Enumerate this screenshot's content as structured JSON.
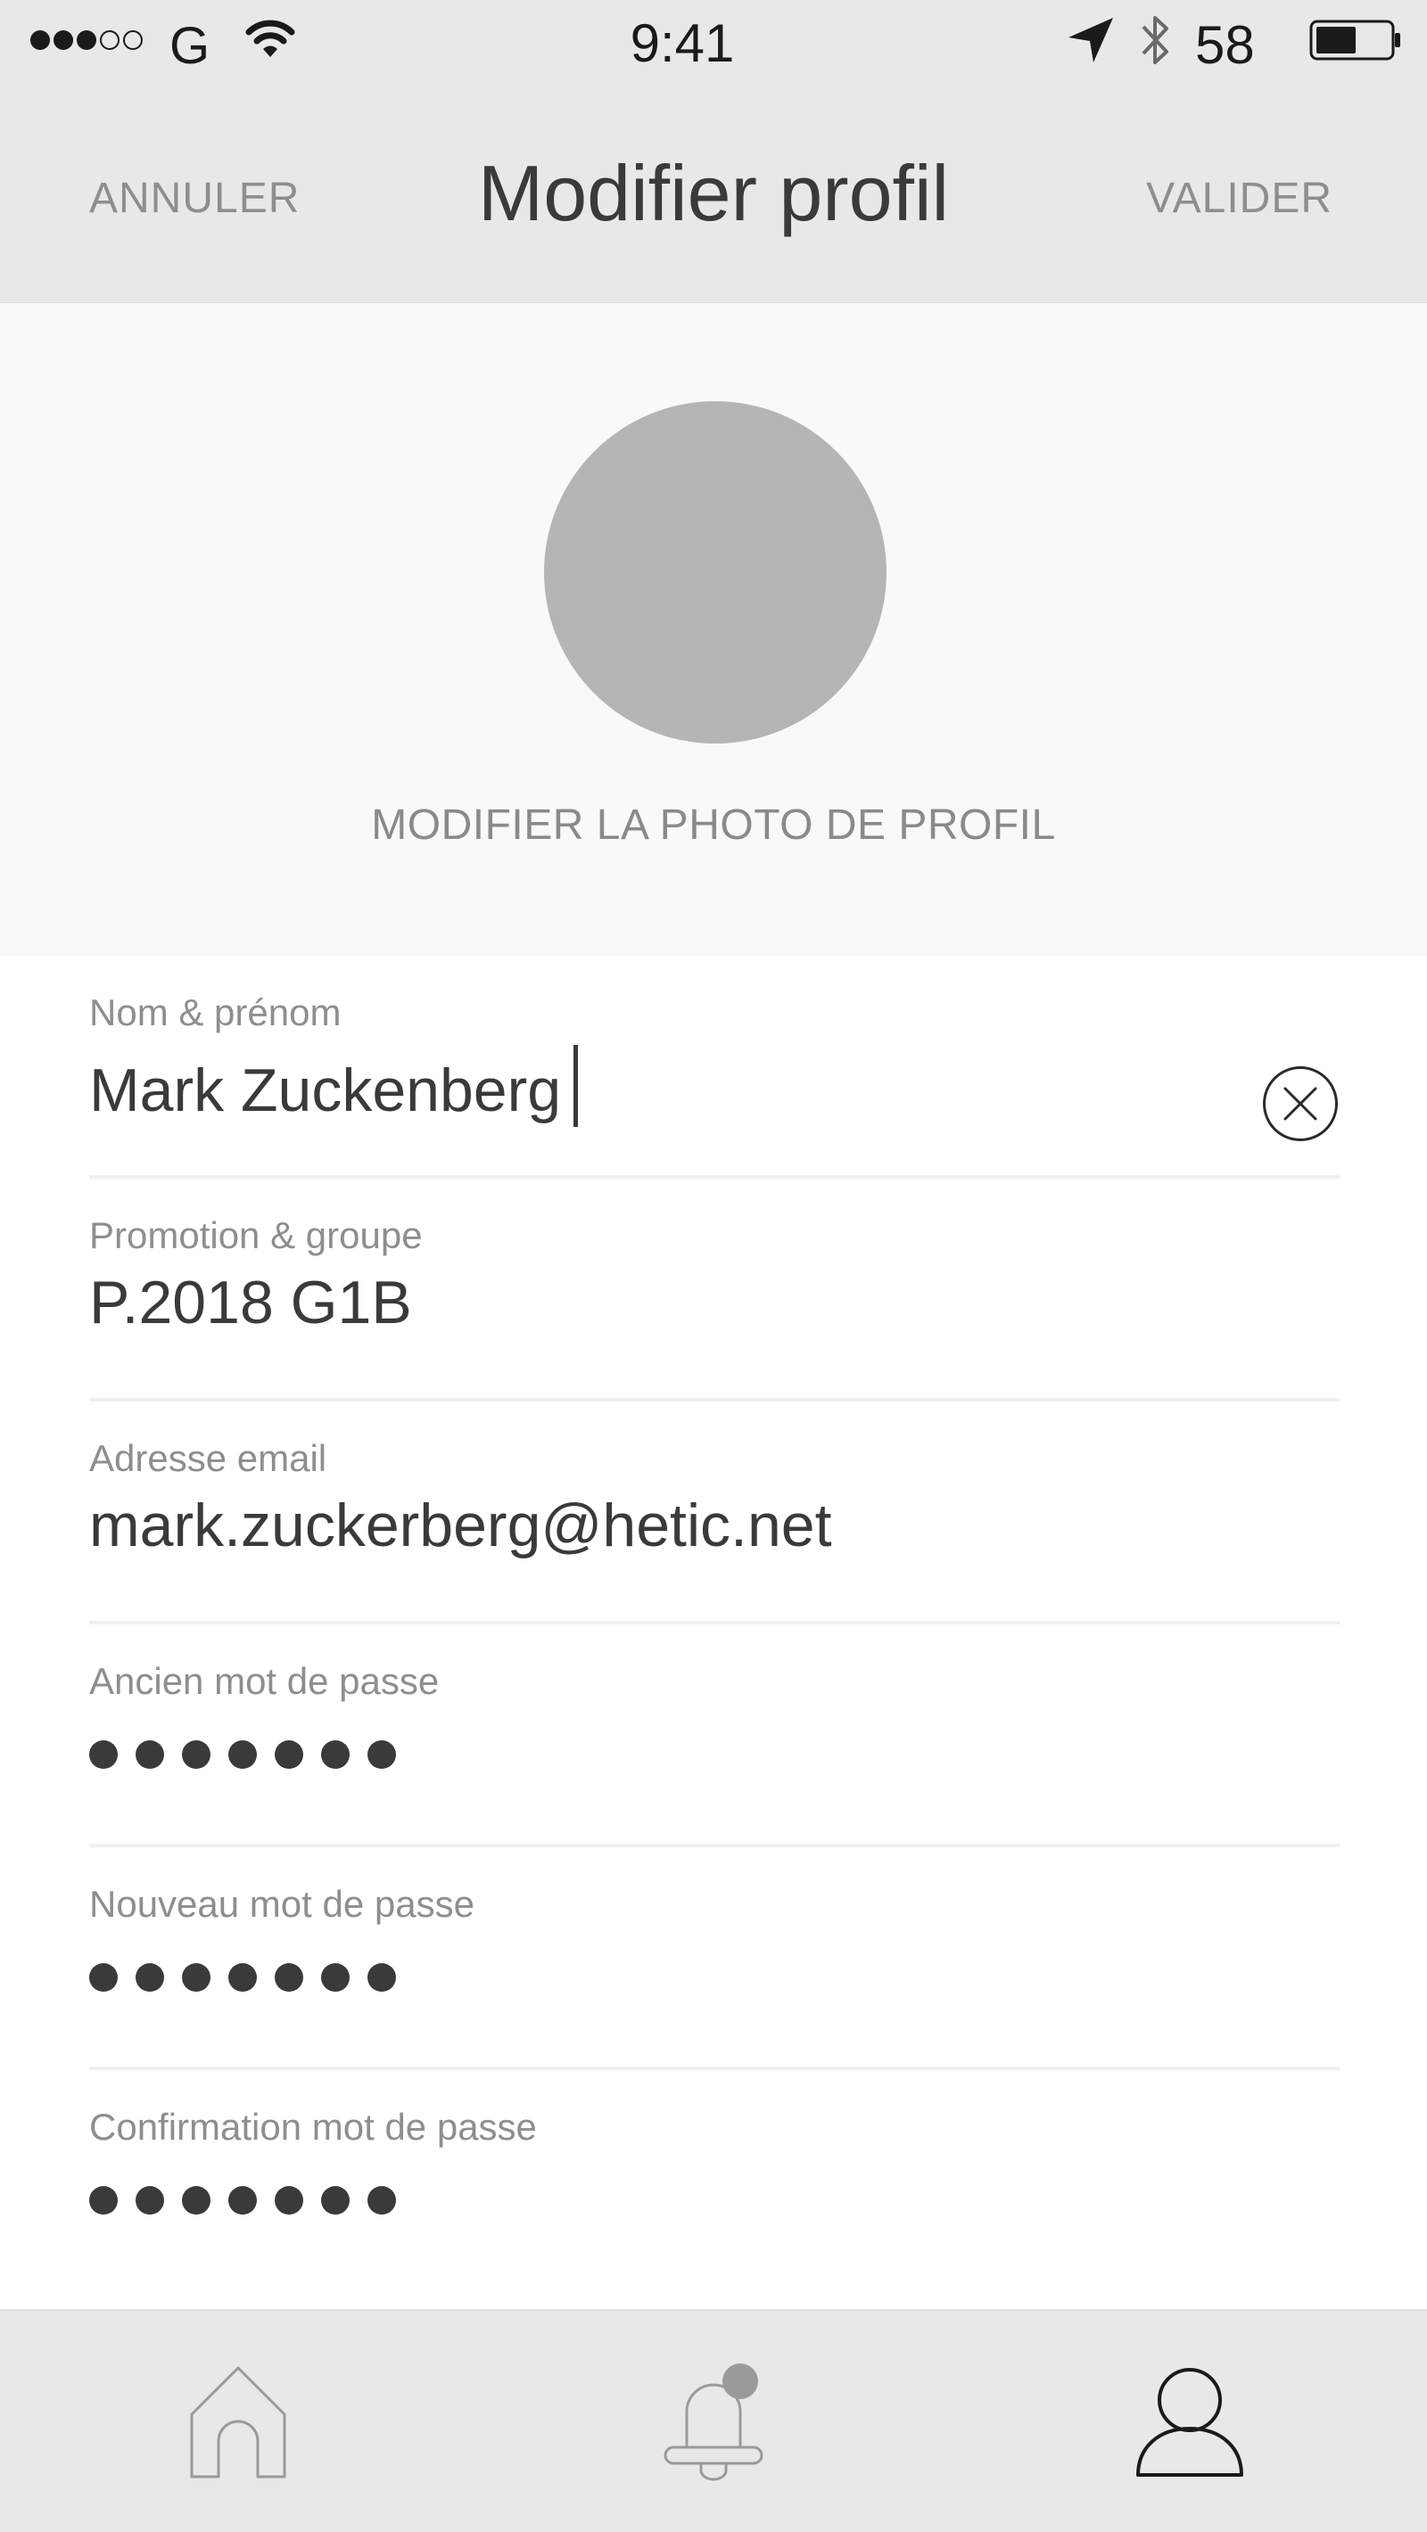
{
  "status_bar": {
    "carrier": "G",
    "time": "9:41",
    "battery_percent": "58",
    "signal_bars_filled": 3,
    "signal_bars_total": 5
  },
  "nav": {
    "cancel_label": "ANNULER",
    "title": "Modifier profil",
    "validate_label": "VALIDER"
  },
  "photo": {
    "change_label": "MODIFIER LA PHOTO DE PROFIL"
  },
  "form": {
    "name": {
      "label": "Nom & prénom",
      "value": "Mark Zuckenberg"
    },
    "promotion": {
      "label": "Promotion & groupe",
      "value": "P.2018 G1B"
    },
    "email": {
      "label": "Adresse email",
      "value": "mark.zuckerberg@hetic.net"
    },
    "old_password": {
      "label": "Ancien mot de passe",
      "masked_length": 7
    },
    "new_password": {
      "label": "Nouveau mot de passe",
      "masked_length": 7
    },
    "confirm_password": {
      "label": "Confirmation mot de passe",
      "masked_length": 7
    }
  },
  "tab_bar": {
    "tabs": [
      {
        "icon": "home-icon",
        "active": false
      },
      {
        "icon": "bell-icon",
        "active": false,
        "badge": true
      },
      {
        "icon": "user-icon",
        "active": true
      }
    ]
  },
  "colors": {
    "bar_background": "#e8e8e8",
    "photo_background": "#f9f9f9",
    "avatar_placeholder": "#b5b5b5",
    "text_primary": "#3a3a3a",
    "text_secondary": "#8e8e8e"
  }
}
